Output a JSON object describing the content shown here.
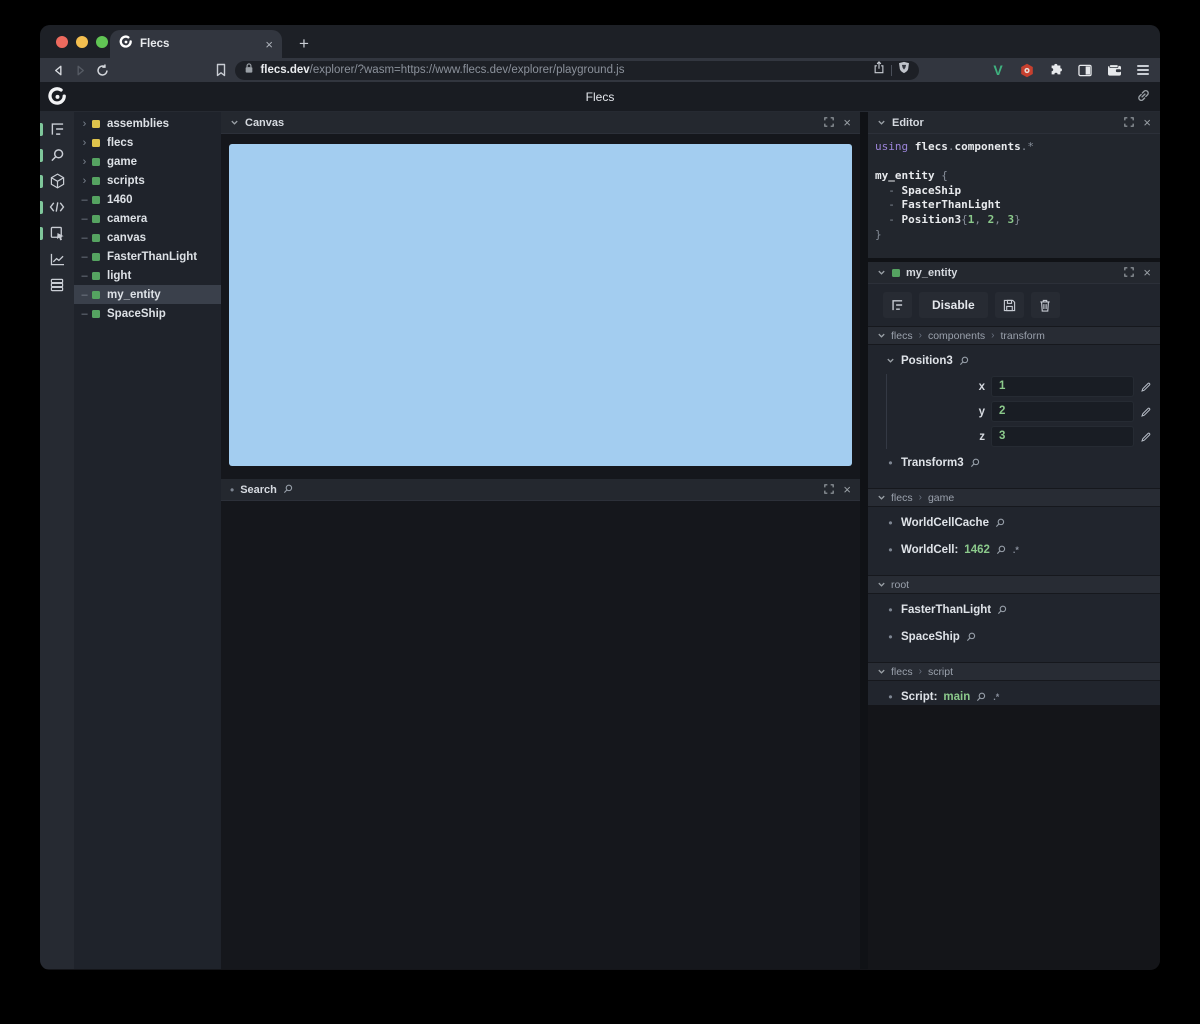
{
  "browser": {
    "tab_title": "Flecs",
    "url_domain": "flecs.dev",
    "url_path": "/explorer/?wasm=https://www.flecs.dev/explorer/playground.js",
    "extensions": {
      "vue_label": "V"
    }
  },
  "app": {
    "title": "Flecs"
  },
  "glyphs": {
    "close": "×",
    "plus": "+",
    "expand_chevron": "›",
    "leaf_dash": "–",
    "bullet": "•",
    "path_separator": "›"
  },
  "colors": {
    "tree_yellow": "#dec34c",
    "tree_green": "#55a361",
    "value_green": "#8bc98b",
    "canvas_blue": "#a3cdf0",
    "keyword_purple": "#9b84d8",
    "active_indicator_green": "#7fc79b",
    "traffic_red": "#ed6a5e",
    "traffic_yellow": "#f4bf4f",
    "traffic_green": "#61c554",
    "vue_green": "#3fb27f",
    "extension_red": "#c7402f"
  },
  "icons": [
    "flecs-logo",
    "outline-icon",
    "search-icon",
    "cube-icon",
    "code-icon",
    "inspector-icon",
    "chart-icon",
    "rows-icon",
    "fullscreen-icon",
    "close-icon",
    "chevron-down-icon",
    "magnifier-icon",
    "pencil-icon",
    "filter-icon",
    "save-icon",
    "trash-icon",
    "back-icon",
    "forward-icon",
    "reload-icon",
    "bookmark-icon",
    "lock-icon",
    "share-icon",
    "shield-icon",
    "vue-icon",
    "hexagon-icon",
    "puzzle-icon",
    "sidebar-toggle-icon",
    "wallet-icon",
    "menu-icon",
    "plus-icon",
    "link-icon"
  ],
  "tool_sidebar": {
    "icons": [
      {
        "name": "outline-icon",
        "active": true
      },
      {
        "name": "search-icon",
        "active": true
      },
      {
        "name": "cube-icon",
        "active": true
      },
      {
        "name": "code-icon",
        "active": true
      },
      {
        "name": "inspector-icon",
        "active": true
      },
      {
        "name": "chart-icon",
        "active": false
      },
      {
        "name": "rows-icon",
        "active": false
      }
    ]
  },
  "tree": {
    "items": [
      {
        "label": "assemblies",
        "color": "tree_yellow",
        "expandable": true,
        "selected": false
      },
      {
        "label": "flecs",
        "color": "tree_yellow",
        "expandable": true,
        "selected": false
      },
      {
        "label": "game",
        "color": "tree_green",
        "expandable": true,
        "selected": false
      },
      {
        "label": "scripts",
        "color": "tree_green",
        "expandable": true,
        "selected": false
      },
      {
        "label": "1460",
        "color": "tree_green",
        "expandable": false,
        "selected": false
      },
      {
        "label": "camera",
        "color": "tree_green",
        "expandable": false,
        "selected": false
      },
      {
        "label": "canvas",
        "color": "tree_green",
        "expandable": false,
        "selected": false
      },
      {
        "label": "FasterThanLight",
        "color": "tree_green",
        "expandable": false,
        "selected": false
      },
      {
        "label": "light",
        "color": "tree_green",
        "expandable": false,
        "selected": false
      },
      {
        "label": "my_entity",
        "color": "tree_green",
        "expandable": false,
        "selected": true
      },
      {
        "label": "SpaceShip",
        "color": "tree_green",
        "expandable": false,
        "selected": false
      }
    ]
  },
  "panels": {
    "canvas": {
      "title": "Canvas"
    },
    "search": {
      "title": "Search"
    },
    "editor": {
      "title": "Editor",
      "code_lines": [
        [
          {
            "t": "using ",
            "c": "kw"
          },
          {
            "t": "flecs",
            "c": "id"
          },
          {
            "t": ".",
            "c": "p"
          },
          {
            "t": "components",
            "c": "id"
          },
          {
            "t": ".*",
            "c": "p"
          }
        ],
        [],
        [
          {
            "t": "my_entity",
            "c": "id"
          },
          {
            "t": " {",
            "c": "p"
          }
        ],
        [
          {
            "t": "  - ",
            "c": "p"
          },
          {
            "t": "SpaceShip",
            "c": "id"
          }
        ],
        [
          {
            "t": "  - ",
            "c": "p"
          },
          {
            "t": "FasterThanLight",
            "c": "id"
          }
        ],
        [
          {
            "t": "  - ",
            "c": "p"
          },
          {
            "t": "Position3",
            "c": "id"
          },
          {
            "t": "{",
            "c": "p"
          },
          {
            "t": "1",
            "c": "num"
          },
          {
            "t": ", ",
            "c": "p"
          },
          {
            "t": "2",
            "c": "num"
          },
          {
            "t": ", ",
            "c": "p"
          },
          {
            "t": "3",
            "c": "num"
          },
          {
            "t": "}",
            "c": "p"
          }
        ],
        [
          {
            "t": "}",
            "c": "p"
          }
        ]
      ]
    },
    "entity": {
      "title": "my_entity",
      "toolbar": {
        "disable_label": "Disable"
      },
      "sections": [
        {
          "path": [
            "flecs",
            "components",
            "transform"
          ],
          "items": [
            {
              "name": "Position3",
              "state": "expanded",
              "fields": [
                {
                  "label": "x",
                  "value": "1"
                },
                {
                  "label": "y",
                  "value": "2"
                },
                {
                  "label": "z",
                  "value": "3"
                }
              ]
            },
            {
              "name": "Transform3",
              "state": "collapsed"
            }
          ]
        },
        {
          "path": [
            "flecs",
            "game"
          ],
          "items": [
            {
              "name": "WorldCellCache",
              "state": "collapsed"
            },
            {
              "name": "WorldCell",
              "state": "collapsed",
              "value": "1462",
              "suffix": ".*"
            }
          ]
        },
        {
          "path": [
            "root"
          ],
          "items": [
            {
              "name": "FasterThanLight",
              "state": "collapsed"
            },
            {
              "name": "SpaceShip",
              "state": "collapsed"
            }
          ]
        },
        {
          "path": [
            "flecs",
            "script"
          ],
          "items": [
            {
              "name": "Script",
              "state": "collapsed",
              "value": "main",
              "suffix": ".*"
            }
          ]
        }
      ]
    }
  }
}
